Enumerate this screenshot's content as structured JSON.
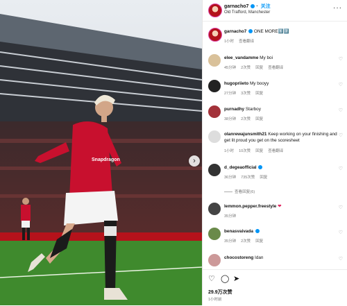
{
  "header": {
    "username": "garnacho7",
    "follow": "关注",
    "location": "Old Trafford, Manchester",
    "more": "···"
  },
  "caption": {
    "username": "garnacho7",
    "text": "ONE MORE1️⃣7️⃣",
    "time": "1小时",
    "translate": "查看翻译"
  },
  "comments": [
    {
      "user": "elee_vandamme",
      "text": "My boi",
      "meta": [
        "45分钟",
        "2次赞",
        "回复",
        "查看翻译"
      ]
    },
    {
      "user": "hugopriieto",
      "text": "My booyy",
      "meta": [
        "27分钟",
        "3次赞",
        "回复"
      ]
    },
    {
      "user": "purnadhy",
      "text": "Starboy",
      "meta": [
        "38分钟",
        "2次赞",
        "回复"
      ]
    },
    {
      "user": "olanrewajunsmith21",
      "text": "Keep working on your finishing and get lit proud you get on the scoresheet",
      "meta": [
        "1小时",
        "10次赞",
        "回复",
        "查看翻译"
      ]
    },
    {
      "user": "d_degeaofficial",
      "text": "",
      "meta": [
        "36分钟",
        "735次赞",
        "回复"
      ],
      "hidden": "查看回复(6)"
    },
    {
      "user": "lemmon.pepper.freestyle",
      "text": "",
      "meta": [
        "35分钟"
      ]
    },
    {
      "user": "benasvaivada",
      "text": "",
      "meta": [
        "35分钟",
        "2次赞",
        "回复"
      ]
    },
    {
      "user": "chocostoreng",
      "text": "Idan",
      "meta": []
    }
  ],
  "actions": {
    "likes": "29.9万次赞",
    "time": "1小时前"
  },
  "colors": {
    "link": "#0095f6",
    "pitch": "#3f8a2d",
    "kit": "#c8102e"
  },
  "icons": [
    "more-icon",
    "heart-icon",
    "comment-icon",
    "share-icon",
    "chevron-right-icon",
    "verified-icon"
  ]
}
